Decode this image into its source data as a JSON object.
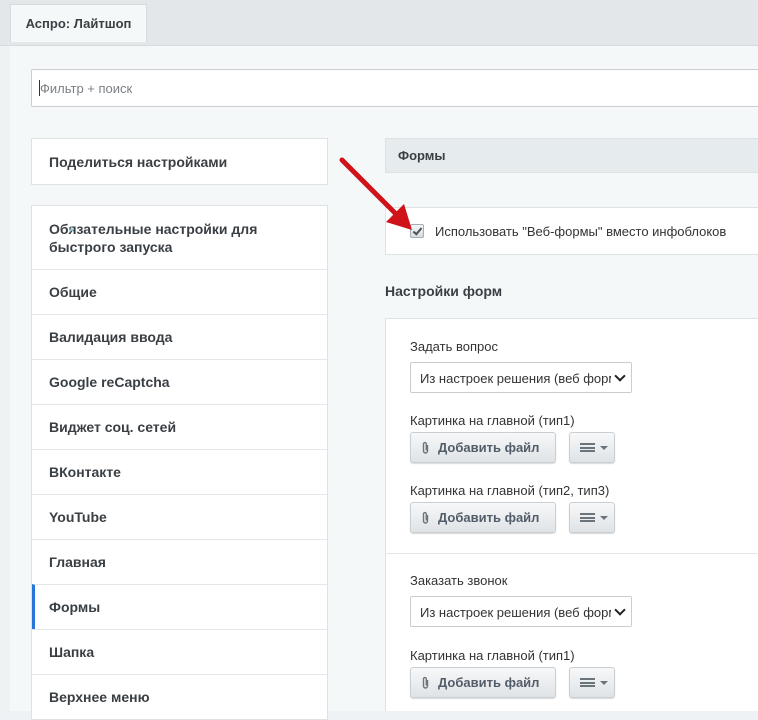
{
  "tab": {
    "label": "Аспро: Лайтшоп"
  },
  "search": {
    "placeholder": "Фильтр + поиск"
  },
  "sidebar": {
    "share_label": "Поделиться настройками",
    "items": [
      {
        "label": "Обязательные настройки для быстрого запуска",
        "icon": "star-icon"
      },
      {
        "label": "Общие"
      },
      {
        "label": "Валидация ввода"
      },
      {
        "label": "Google reCaptcha"
      },
      {
        "label": "Виджет соц. сетей"
      },
      {
        "label": "ВКонтакте"
      },
      {
        "label": "YouTube"
      },
      {
        "label": "Главная"
      },
      {
        "label": "Формы",
        "active": true
      },
      {
        "label": "Шапка"
      },
      {
        "label": "Верхнее меню"
      }
    ],
    "star_glyph": "*"
  },
  "main": {
    "section_title": "Формы",
    "use_webforms": {
      "label": "Использовать \"Веб-формы\" вместо инфоблоков",
      "checked": true
    },
    "settings_title": "Настройки форм",
    "groups": [
      {
        "select_label": "Задать вопрос",
        "select_value": "Из настроек решения (веб формы)",
        "image1_label": "Картинка на главной (тип1)",
        "image2_label": "Картинка на главной (тип2, тип3)"
      },
      {
        "select_label": "Заказать звонок",
        "select_value": "Из настроек решения (веб формы)",
        "image1_label": "Картинка на главной (тип1)"
      }
    ],
    "add_file_label": "Добавить файл"
  },
  "colors": {
    "accent": "#2675d7",
    "arrow": "#d0121b"
  }
}
